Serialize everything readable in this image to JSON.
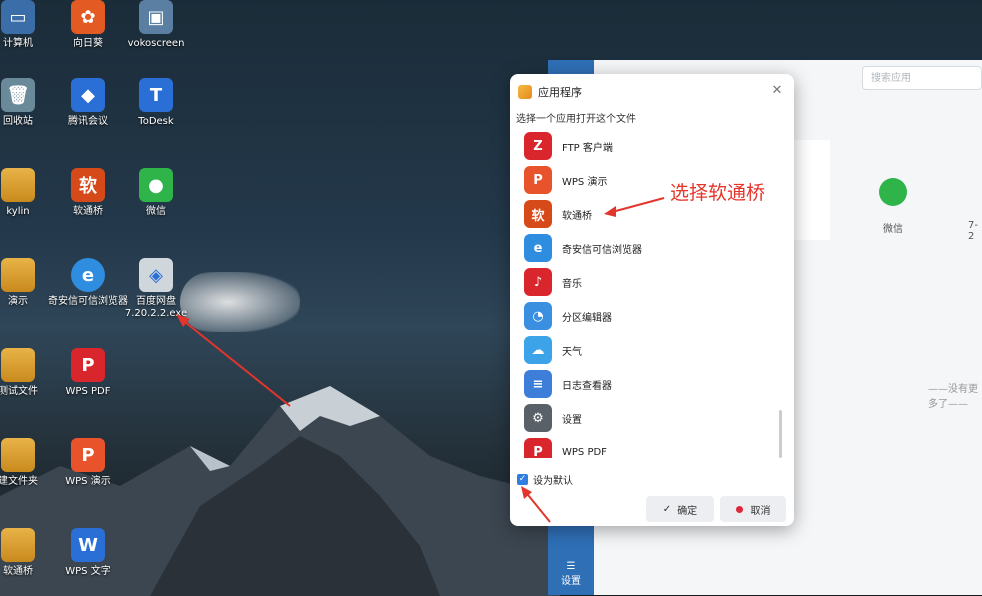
{
  "desktop": {
    "icons": [
      {
        "label": "计算机"
      },
      {
        "label": "向日葵"
      },
      {
        "label": "vokoscreen"
      },
      {
        "label": "回收站"
      },
      {
        "label": "腾讯会议"
      },
      {
        "label": "ToDesk"
      },
      {
        "label": "kylin"
      },
      {
        "label": "软通桥"
      },
      {
        "label": "微信"
      },
      {
        "label": "演示"
      },
      {
        "label": "奇安信可信浏览器"
      },
      {
        "label": "百度网盘7.20.2.2.exe"
      },
      {
        "label": "测试文件"
      },
      {
        "label": "WPS PDF"
      },
      {
        "label": "建文件夹"
      },
      {
        "label": "WPS 演示"
      },
      {
        "label": "软通桥"
      },
      {
        "label": "WPS 文字"
      }
    ]
  },
  "bg_app": {
    "search_placeholder": "搜索应用",
    "wechat_label": "微信",
    "partial_label": "7-2",
    "no_more_text": "——没有更多了——",
    "settings_label": "设置"
  },
  "dialog": {
    "title": "应用程序",
    "prompt": "选择一个应用打开这个文件",
    "apps": [
      {
        "name": "FTP 客户端",
        "icon": "filezilla-icon",
        "color": "#d9262c",
        "glyph": "Z"
      },
      {
        "name": "WPS 演示",
        "icon": "wps-presentation-icon",
        "color": "#e8532b",
        "glyph": "P"
      },
      {
        "name": "软通桥",
        "icon": "ruantongqiao-icon",
        "color": "#d64a1a",
        "glyph": "软"
      },
      {
        "name": "奇安信可信浏览器",
        "icon": "qianxin-browser-icon",
        "color": "#2f8de0",
        "glyph": "e"
      },
      {
        "name": "音乐",
        "icon": "music-icon",
        "color": "#d9262c",
        "glyph": "♪"
      },
      {
        "name": "分区编辑器",
        "icon": "partition-editor-icon",
        "color": "#3a8fe0",
        "glyph": "◔"
      },
      {
        "name": "天气",
        "icon": "weather-icon",
        "color": "#3ca3e8",
        "glyph": "☁"
      },
      {
        "name": "日志查看器",
        "icon": "log-viewer-icon",
        "color": "#3d7fd8",
        "glyph": "≡"
      },
      {
        "name": "设置",
        "icon": "settings-icon",
        "color": "#5a6068",
        "glyph": "⚙"
      },
      {
        "name": "WPS PDF",
        "icon": "wps-pdf-icon",
        "color": "#d9262c",
        "glyph": "P"
      }
    ],
    "set_default_label": "设为默认",
    "set_default_checked": true,
    "ok_label": "确定",
    "cancel_label": "取消"
  },
  "annotation": {
    "text": "选择软通桥",
    "color": "#e3352b"
  }
}
